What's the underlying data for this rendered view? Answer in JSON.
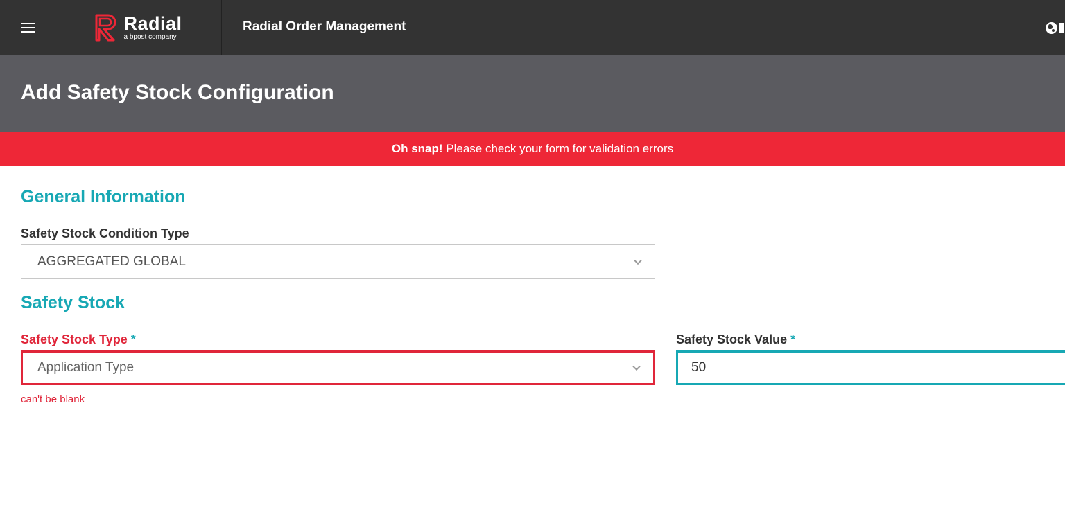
{
  "topbar": {
    "menu_icon": "hamburger-menu-icon",
    "brand_name": "Radial",
    "brand_tagline": "a bpost company",
    "app_title": "Radial Order Management",
    "globe_icon": "globe-icon"
  },
  "page": {
    "title": "Add Safety Stock Configuration"
  },
  "alert": {
    "bold_text": "Oh snap!",
    "message": " Please check your form for validation errors",
    "color": "#ee2737"
  },
  "general": {
    "section_title": "General Information",
    "condition_type_label": "Safety Stock Condition Type",
    "condition_type_value": "AGGREGATED GLOBAL"
  },
  "safety_stock": {
    "section_title": "Safety Stock",
    "type_label": "Safety Stock Type",
    "type_required": "*",
    "type_placeholder": "Application Type",
    "type_error": "can't be blank",
    "value_label": "Safety Stock Value",
    "value_required": "*",
    "value": "50"
  },
  "colors": {
    "accent": "#17a8b4",
    "error": "#e0263a",
    "topbar": "#333333",
    "header": "#5b5b60"
  }
}
